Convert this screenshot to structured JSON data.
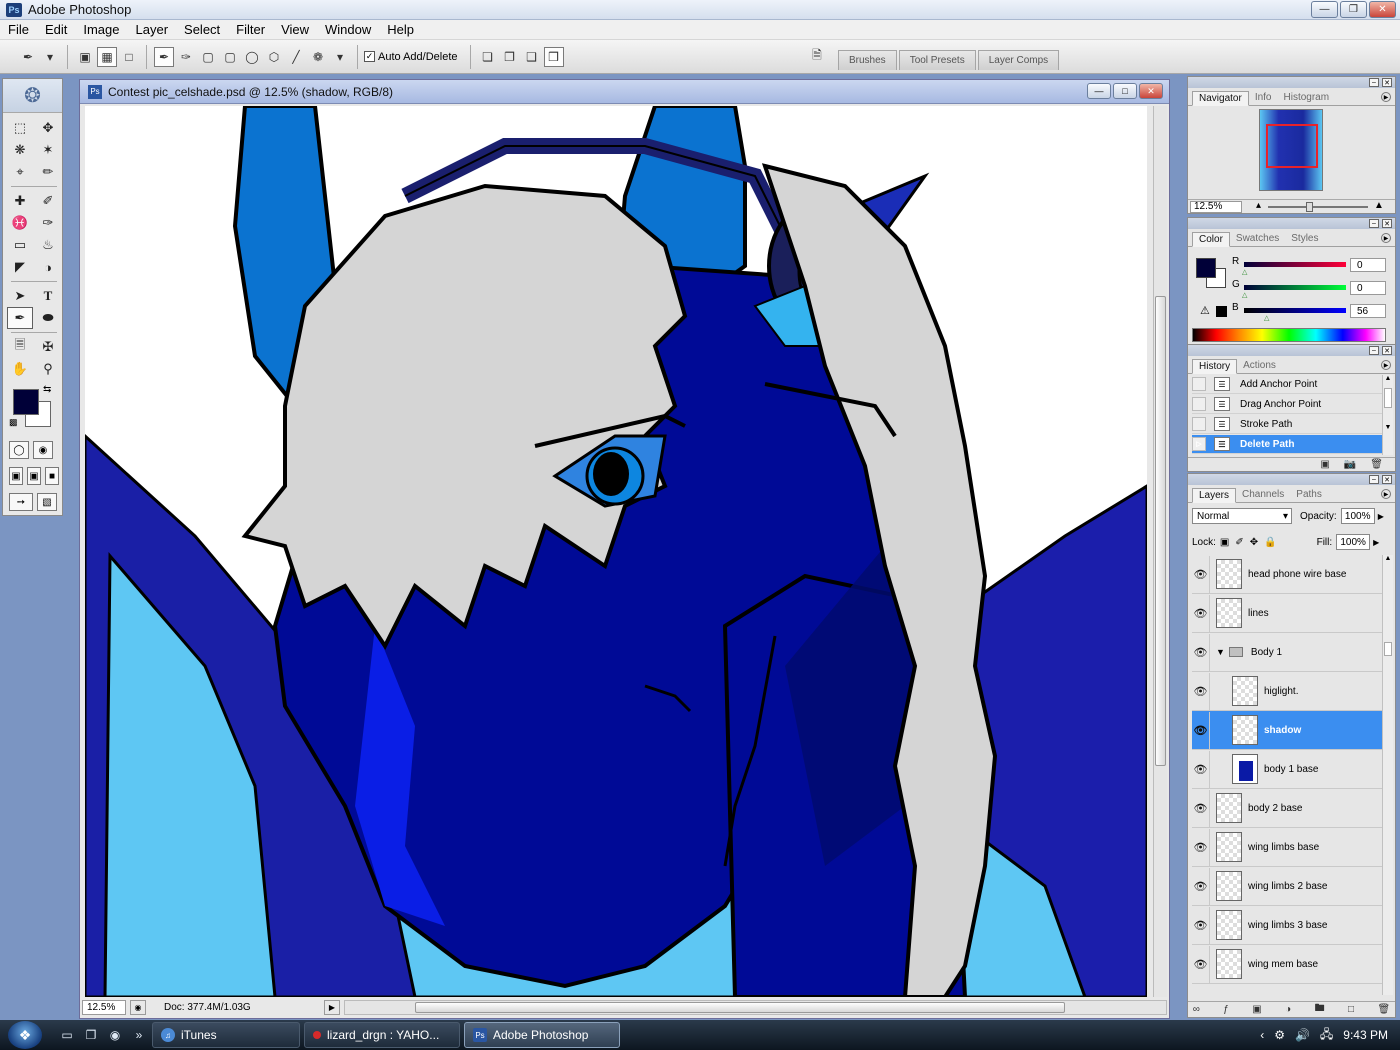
{
  "app": {
    "title": "Adobe Photoshop"
  },
  "menu": [
    "File",
    "Edit",
    "Image",
    "Layer",
    "Select",
    "Filter",
    "View",
    "Window",
    "Help"
  ],
  "options": {
    "auto_add_delete_label": "Auto Add/Delete"
  },
  "palette_well": {
    "tabs": [
      "Brushes",
      "Tool Presets",
      "Layer Comps"
    ]
  },
  "document": {
    "title": "Contest pic_celshade.psd @ 12.5% (shadow, RGB/8)",
    "zoom": "12.5%",
    "doc_info": "Doc: 377.4M/1.03G"
  },
  "navigator": {
    "tabs": [
      "Navigator",
      "Info",
      "Histogram"
    ],
    "zoom": "12.5%"
  },
  "color": {
    "tabs": [
      "Color",
      "Swatches",
      "Styles"
    ],
    "channels": [
      {
        "label": "R",
        "value": "0"
      },
      {
        "label": "G",
        "value": "0"
      },
      {
        "label": "B",
        "value": "56"
      }
    ],
    "foreground": "#000038"
  },
  "history": {
    "tabs": [
      "History",
      "Actions"
    ],
    "items": [
      "Add Anchor Point",
      "Drag Anchor Point",
      "Stroke Path",
      "Delete Path"
    ],
    "selected_index": 3
  },
  "layers": {
    "tabs": [
      "Layers",
      "Channels",
      "Paths"
    ],
    "blend_mode": "Normal",
    "opacity_label": "Opacity:",
    "opacity": "100%",
    "lock_label": "Lock:",
    "fill_label": "Fill:",
    "fill": "100%",
    "items": [
      {
        "name": "head phone wire base"
      },
      {
        "name": "lines"
      },
      {
        "name": "Body 1"
      },
      {
        "name": "higlight."
      },
      {
        "name": "shadow"
      },
      {
        "name": "body 1 base"
      },
      {
        "name": "body 2 base"
      },
      {
        "name": "wing limbs base"
      },
      {
        "name": "wing limbs 2 base"
      },
      {
        "name": "wing limbs 3 base"
      },
      {
        "name": "wing mem base"
      }
    ],
    "selected": "shadow"
  },
  "taskbar": {
    "buttons": [
      "iTunes",
      "lizard_drgn : YAHO...",
      "Adobe Photoshop"
    ],
    "clock": "9:43 PM"
  }
}
